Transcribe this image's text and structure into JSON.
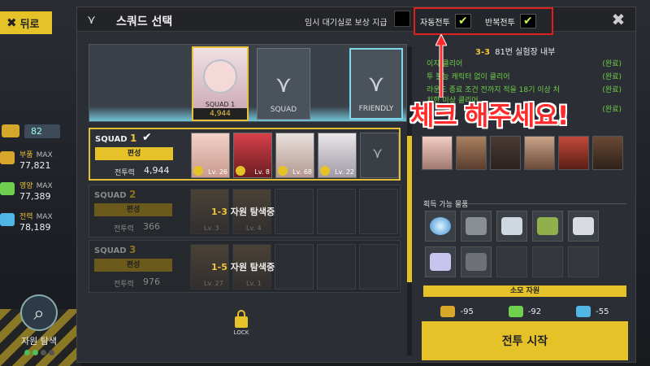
{
  "back": {
    "label": "뒤로"
  },
  "left": {
    "count": "82",
    "resources": [
      {
        "name": "부품",
        "max": "MAX",
        "value": "77,821",
        "color": "#d9a62c"
      },
      {
        "name": "영양",
        "max": "MAX",
        "value": "77,389",
        "color": "#6fd04f"
      },
      {
        "name": "전력",
        "max": "MAX",
        "value": "78,189",
        "color": "#4fb6e6"
      }
    ],
    "search_label": "자원 탐색"
  },
  "dialog": {
    "title": "스쿼드 선택",
    "reward_label": "임시 대기실로 보상 지급",
    "auto_battle_label": "자동전투",
    "repeat_battle_label": "반복전투",
    "auto_checked": true,
    "repeat_checked": true
  },
  "top_slots": {
    "lead_squad_label": "SQUAD",
    "lead_squad_num": "1",
    "lead_power": "4,944",
    "squad_slot_label": "SQUAD",
    "friendly_slot_label": "FRIENDLY"
  },
  "squads": [
    {
      "label": "SQUAD",
      "num": "1",
      "edit": "편성",
      "power_label": "전투력",
      "power": "4,944",
      "members": [
        {
          "lv": "Lv. 26"
        },
        {
          "lv": "Lv. 8"
        },
        {
          "lv": "Lv. 68"
        },
        {
          "lv": "Lv. 22"
        }
      ]
    },
    {
      "label": "SQUAD",
      "num": "2",
      "edit": "편성",
      "power_label": "전투력",
      "power": "366",
      "status_stage": "1-3",
      "status_text": "자원 탐색중",
      "members": [
        {
          "lv": "Lv. 3"
        },
        {
          "lv": "Lv. 4"
        }
      ]
    },
    {
      "label": "SQUAD",
      "num": "3",
      "edit": "편성",
      "power_label": "전투력",
      "power": "976",
      "status_stage": "1-5",
      "status_text": "자원 탐색중",
      "members": [
        {
          "lv": "Lv. 27"
        },
        {
          "lv": "Lv. 1"
        }
      ]
    }
  ],
  "lock_label": "LOCK",
  "stage": {
    "code": "3-3",
    "name": "81번 실험장 내부",
    "missions": [
      {
        "text": "이지 클리어",
        "status": "(완료)"
      },
      {
        "text": "투 불능 캐릭터 없이 클리어",
        "status": "(완료)"
      },
      {
        "text": "라운드 종료 조건 전까지 적을 18기 이상 처치한 이상 클리어",
        "status": "(완료)"
      },
      {
        "text": "",
        "status": "(완료)"
      }
    ]
  },
  "obtain_label": "획득 가능 물품",
  "cost": {
    "header": "소모 자원",
    "parts": "-95",
    "nutrition": "-92",
    "power": "-55"
  },
  "start_label": "전투 시작",
  "annotation": "체크 해주세요!"
}
